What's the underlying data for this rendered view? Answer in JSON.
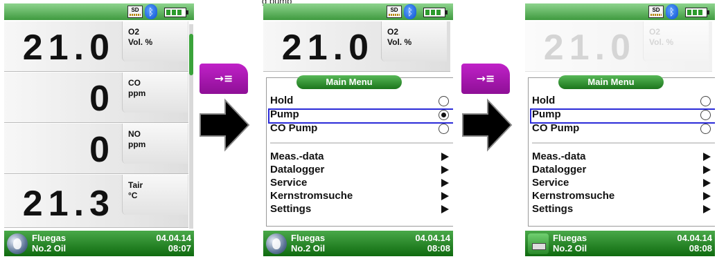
{
  "caption": "g pump",
  "screens": [
    {
      "readings": [
        {
          "value": "21.0",
          "label1": "O2",
          "label2": "Vol. %"
        },
        {
          "value": "0",
          "label1": "CO",
          "label2": "ppm"
        },
        {
          "value": "0",
          "label1": "NO",
          "label2": "ppm"
        },
        {
          "value": "21.3",
          "label1": "Tair",
          "label2": "°C"
        }
      ],
      "footer": {
        "line1": "Fluegas",
        "line2": "No.2 Oil",
        "date": "04.04.14",
        "time": "08:07"
      }
    },
    {
      "reading": {
        "value": "21.0",
        "label1": "O2",
        "label2": "Vol. %"
      },
      "menu": {
        "title": "Main Menu",
        "radio_items": [
          {
            "label": "Hold",
            "selected": false
          },
          {
            "label": "Pump",
            "selected": true
          },
          {
            "label": "CO Pump",
            "selected": false
          }
        ],
        "sub_items": [
          "Meas.-data",
          "Datalogger",
          "Service",
          "Kernstromsuche",
          "Settings"
        ]
      },
      "footer": {
        "line1": "Fluegas",
        "line2": "No.2 Oil",
        "date": "04.04.14",
        "time": "08:08"
      }
    },
    {
      "reading": {
        "value": "21.0",
        "label1": "O2",
        "label2": "Vol. %"
      },
      "menu": {
        "title": "Main Menu",
        "radio_items": [
          {
            "label": "Hold",
            "selected": false
          },
          {
            "label": "Pump",
            "selected": false
          },
          {
            "label": "CO Pump",
            "selected": false
          }
        ],
        "sub_items": [
          "Meas.-data",
          "Datalogger",
          "Service",
          "Kernstromsuche",
          "Settings"
        ]
      },
      "footer": {
        "line1": "Fluegas",
        "line2": "No.2 Oil",
        "date": "04.04.14",
        "time": "08:08"
      }
    }
  ],
  "status": {
    "sd_label": "SD",
    "bluetooth_icon": "bluetooth-icon",
    "battery_icon": "battery-icon"
  },
  "softkey_label": "→≡",
  "colors": {
    "status_green": "#3f9a3f",
    "softkey_magenta": "#b11bbb",
    "selection_blue": "#2a2ad8"
  }
}
